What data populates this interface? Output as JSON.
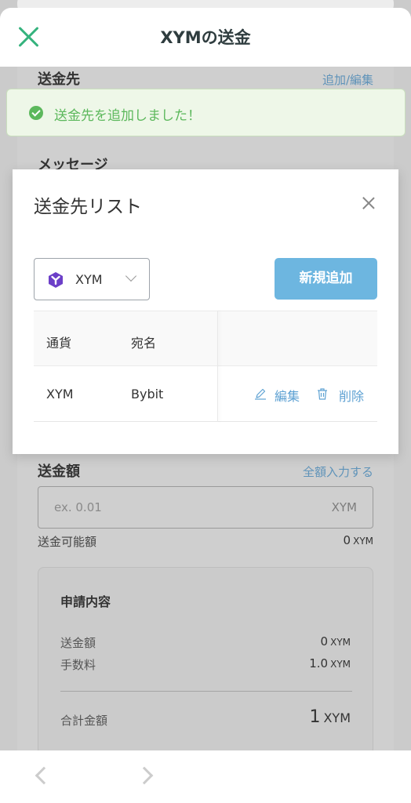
{
  "header": {
    "title": "XYMの送金"
  },
  "form": {
    "recipient": {
      "title": "送金先",
      "link": "追加/編集"
    },
    "message": {
      "title": "メッセージ"
    },
    "amount": {
      "title": "送金額",
      "link": "全額入力する",
      "placeholder": "ex. 0.01",
      "unit": "XYM",
      "available_label": "送金可能額",
      "available_value": "0",
      "available_unit": "XYM"
    },
    "summary": {
      "title": "申請内容",
      "rows": [
        {
          "label": "送金額",
          "value": "0",
          "unit": "XYM"
        },
        {
          "label": "手数料",
          "value": "1.0",
          "unit": "XYM"
        }
      ],
      "total_label": "合計金額",
      "total_value": "1",
      "total_unit": "XYM"
    }
  },
  "toast": {
    "text": "送金先を追加しました！",
    "color": "#5cb85c"
  },
  "modal": {
    "title": "送金先リスト",
    "currency_select": {
      "value": "XYM",
      "icon": "symbol-logo-icon"
    },
    "add_button": "新規追加",
    "table": {
      "headers": [
        "通貨",
        "宛名"
      ],
      "rows": [
        {
          "currency": "XYM",
          "name": "Bybit",
          "edit": "編集",
          "delete": "削除"
        }
      ]
    }
  },
  "colors": {
    "accent_green": "#36b37e",
    "link_blue": "#5fa2d3",
    "button_blue": "#6db6e0",
    "symbol_purple": "#6c3fc8"
  }
}
